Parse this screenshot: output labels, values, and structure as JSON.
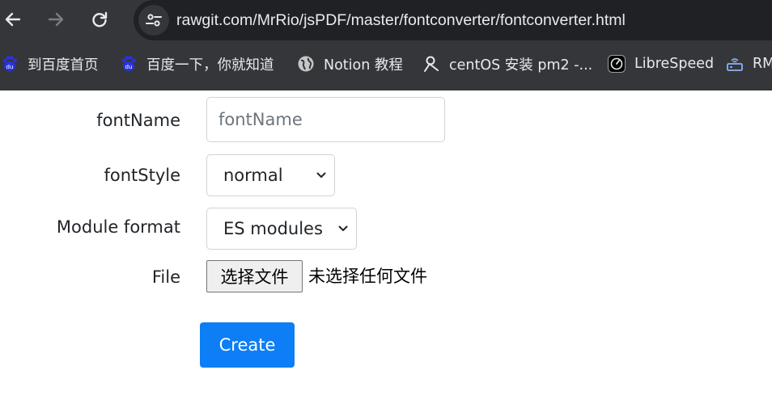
{
  "browser": {
    "url": "rawgit.com/MrRio/jsPDF/master/fontconverter/fontconverter.html",
    "bookmarks": [
      {
        "label": "到百度首页",
        "icon": "baidu-icon"
      },
      {
        "label": "百度一下，你就知道",
        "icon": "baidu-icon"
      },
      {
        "label": "Notion 教程",
        "icon": "globe-icon"
      },
      {
        "label": "centOS 安装 pm2 -...",
        "icon": "bookmark-logo-icon"
      },
      {
        "label": "LibreSpeed",
        "icon": "speedometer-icon"
      },
      {
        "label": "RM",
        "icon": "router-icon"
      }
    ]
  },
  "form": {
    "font_name": {
      "label": "fontName",
      "placeholder": "fontName",
      "value": ""
    },
    "font_style": {
      "label": "fontStyle",
      "selected": "normal"
    },
    "module_format": {
      "label": "Module format",
      "selected": "ES modules"
    },
    "file": {
      "label": "File",
      "button": "选择文件",
      "status": "未选择任何文件"
    },
    "create_label": "Create"
  },
  "colors": {
    "toolbar": "#35363a",
    "omnibox": "#202124",
    "primary_button": "#0d7ef5",
    "text": "#212529"
  }
}
